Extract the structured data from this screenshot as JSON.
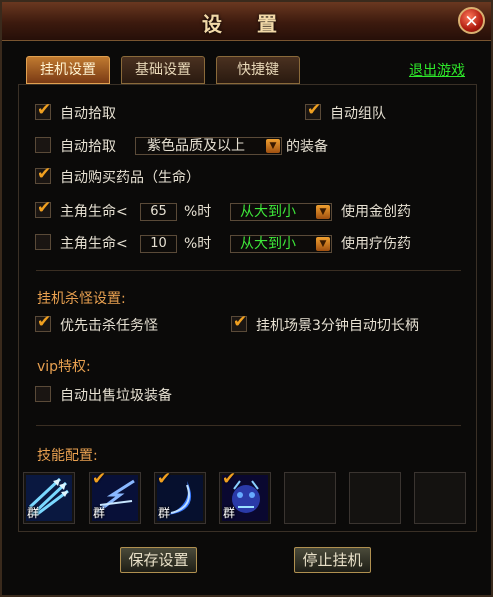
{
  "window": {
    "title": "设 置",
    "close_label": "✕"
  },
  "tabs": [
    {
      "label": "挂机设置",
      "active": true
    },
    {
      "label": "基础设置",
      "active": false
    },
    {
      "label": "快捷键",
      "active": false
    }
  ],
  "exit_link": "退出游戏",
  "options": {
    "auto_pickup": {
      "label": "自动拾取",
      "checked": true
    },
    "auto_team": {
      "label": "自动组队",
      "checked": true
    },
    "auto_pickup_quality": {
      "label": "自动拾取",
      "checked": false,
      "select_value": "紫色品质及以上",
      "suffix": "的装备"
    },
    "auto_buy_potion": {
      "label": "自动购买药品（生命）",
      "checked": true
    },
    "hp_potion": {
      "label": "主角生命<",
      "checked": true,
      "value": "65",
      "unit": "%时",
      "order": "从大到小",
      "suffix": "使用金创药"
    },
    "hp_heal": {
      "label": "主角生命<",
      "checked": false,
      "value": "10",
      "unit": "%时",
      "order": "从大到小",
      "suffix": "使用疗伤药"
    }
  },
  "kill_section": {
    "title": "挂机杀怪设置:",
    "priority_quest": {
      "label": "优先击杀任务怪",
      "checked": true
    },
    "switch_target": {
      "label": "挂机场景3分钟自动切长柄",
      "checked": true
    }
  },
  "vip_section": {
    "title": "vip特权:",
    "auto_sell": {
      "label": "自动出售垃圾装备",
      "checked": false
    }
  },
  "skills": {
    "title": "技能配置:",
    "slots": [
      {
        "icon": "ice-arrows-skill-icon",
        "tag": "群",
        "checked": false
      },
      {
        "icon": "lightning-slash-skill-icon",
        "tag": "群",
        "checked": true
      },
      {
        "icon": "crescent-blade-skill-icon",
        "tag": "群",
        "checked": true
      },
      {
        "icon": "demon-summon-skill-icon",
        "tag": "群",
        "checked": true
      },
      {
        "icon": "empty-slot",
        "tag": "",
        "checked": false
      },
      {
        "icon": "empty-slot",
        "tag": "",
        "checked": false
      },
      {
        "icon": "empty-slot",
        "tag": "",
        "checked": false
      }
    ]
  },
  "buttons": {
    "save": "保存设置",
    "stop": "停止挂机"
  },
  "colors": {
    "accent_orange": "#f0a020",
    "link_green": "#2ee82a",
    "select_green": "#3ee83a",
    "section_orange": "#e8a050"
  }
}
